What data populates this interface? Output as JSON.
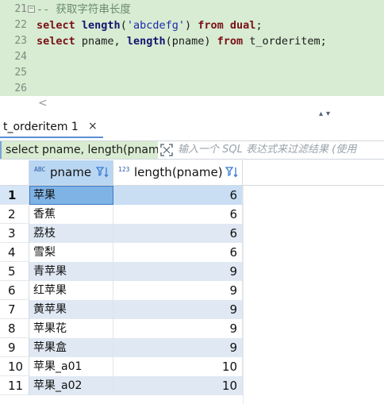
{
  "editor": {
    "lines": [
      {
        "num": "21",
        "fold": "−",
        "comment": "-- 获取字符串长度"
      },
      {
        "num": "22",
        "kw1": "select",
        "fn": "length",
        "p1": "(",
        "str": "'abcdefg'",
        "p2": ") ",
        "kw2": "from",
        "tail_kw": "dual",
        "end": ";"
      },
      {
        "num": "23",
        "kw1": "select",
        "mid": " pname, ",
        "fn": "length",
        "p1": "(pname) ",
        "kw2": "from",
        "tail": " t_orderitem;"
      },
      {
        "num": "24"
      },
      {
        "num": "25"
      },
      {
        "num": "26"
      }
    ]
  },
  "scroll": {
    "left_arrow": "<",
    "updown": "▴▾"
  },
  "tab": {
    "label": "t_orderitem 1",
    "close": "×"
  },
  "filter": {
    "query": "select pname, length(pname) from t_orderitem",
    "placeholder": "输入一个 SQL 表达式来过滤结果 (使用"
  },
  "grid": {
    "columns": [
      {
        "type_badge": "ABC",
        "name": "pname"
      },
      {
        "type_badge": "123",
        "name": "length(pname)"
      }
    ],
    "rows": [
      {
        "n": "1",
        "pname": "苹果",
        "len": "6"
      },
      {
        "n": "2",
        "pname": "香蕉",
        "len": "6"
      },
      {
        "n": "3",
        "pname": "荔枝",
        "len": "6"
      },
      {
        "n": "4",
        "pname": "雪梨",
        "len": "6"
      },
      {
        "n": "5",
        "pname": "青苹果",
        "len": "9"
      },
      {
        "n": "6",
        "pname": "红苹果",
        "len": "9"
      },
      {
        "n": "7",
        "pname": "黄苹果",
        "len": "9"
      },
      {
        "n": "8",
        "pname": "苹果花",
        "len": "9"
      },
      {
        "n": "9",
        "pname": "苹果盒",
        "len": "9"
      },
      {
        "n": "10",
        "pname": "苹果_a01",
        "len": "10"
      },
      {
        "n": "11",
        "pname": "苹果_a02",
        "len": "10"
      }
    ]
  },
  "colors": {
    "editor_bg": "#d7ecd2",
    "selected_cell": "#7fb3e6",
    "alt_row": "#dfe8f3",
    "header_selected": "#b9d6f2"
  }
}
